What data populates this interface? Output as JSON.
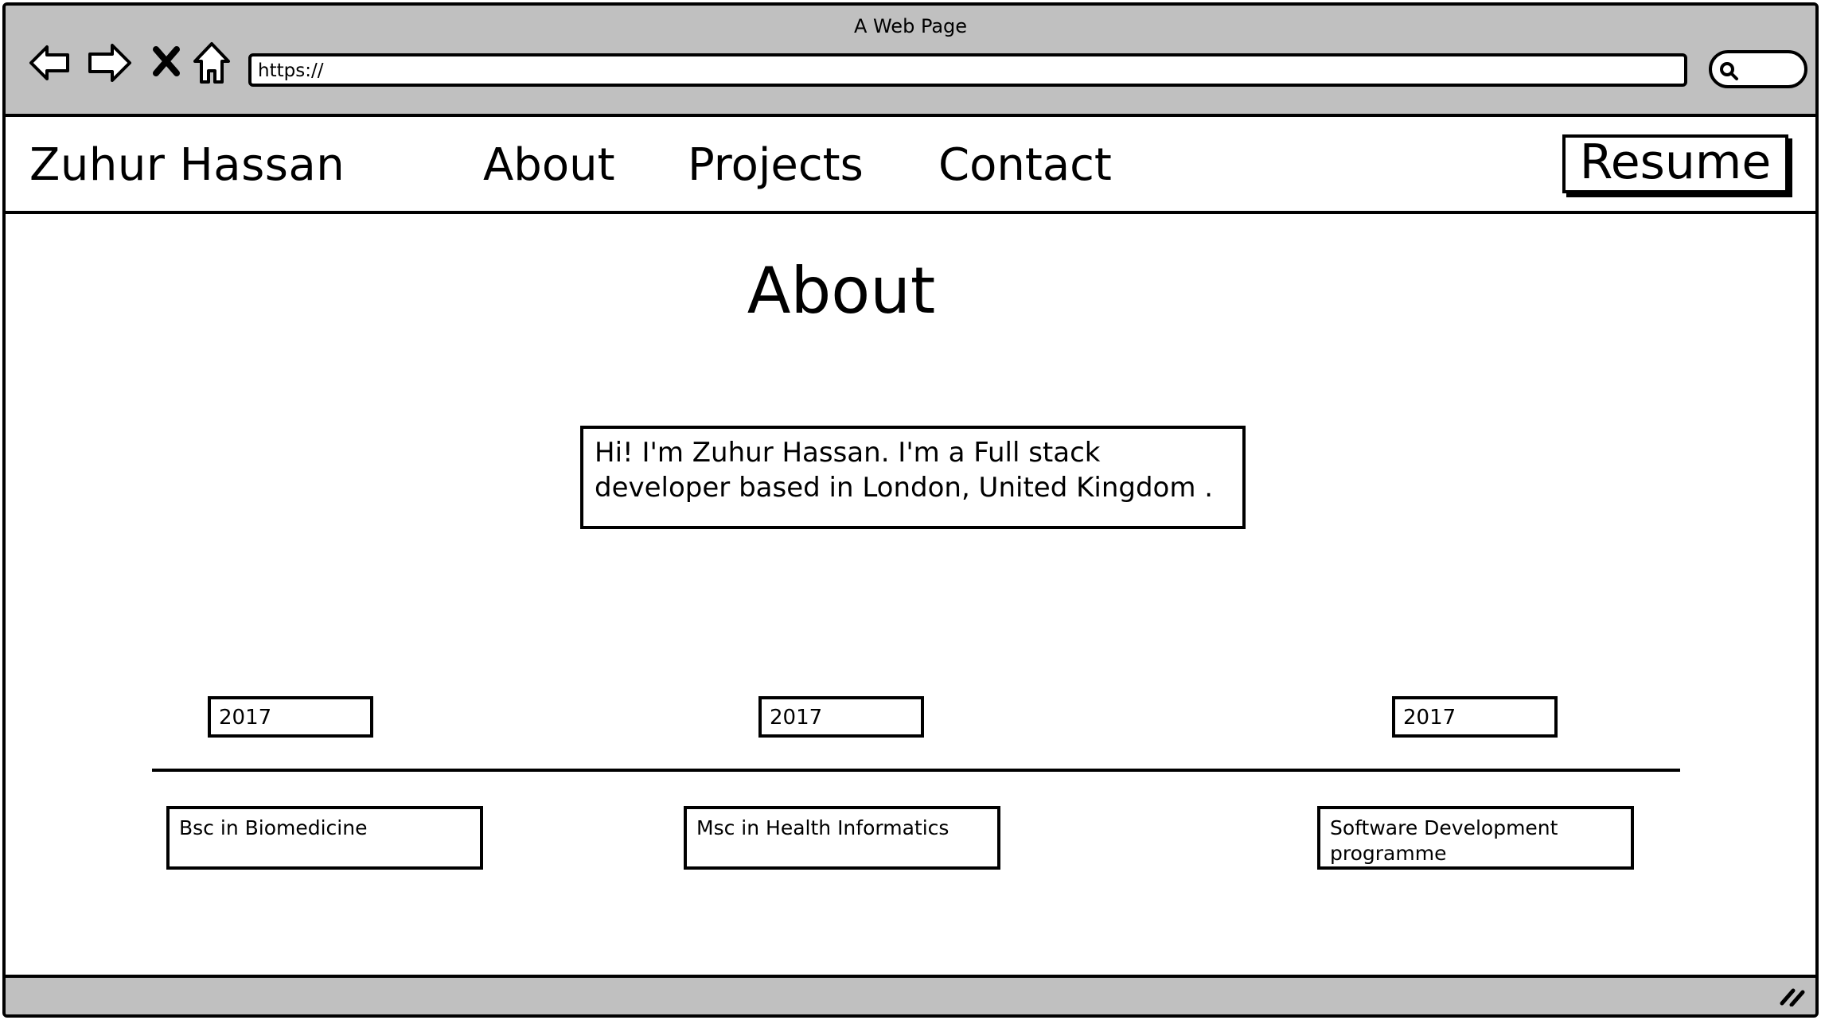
{
  "browser": {
    "window_title": "A Web Page",
    "url": "https://",
    "icons": [
      "back-arrow-icon",
      "forward-arrow-icon",
      "close-x-icon",
      "home-icon",
      "search-icon",
      "resize-grip-icon"
    ]
  },
  "header": {
    "brand": "Zuhur Hassan",
    "nav": [
      "About",
      "Projects",
      "Contact"
    ],
    "resume_label": "Resume"
  },
  "main": {
    "title": "About",
    "intro": "Hi! I'm Zuhur Hassan. I'm a Full stack developer based in London, United Kingdom ."
  },
  "timeline": {
    "years": [
      "2017",
      "2017",
      "2017"
    ],
    "entries": [
      "Bsc in Biomedicine",
      "Msc in Health Informatics",
      "Software Development programme"
    ]
  },
  "colors": {
    "chrome": "#c0c0c0",
    "ink": "#000000",
    "background": "#ffffff"
  }
}
